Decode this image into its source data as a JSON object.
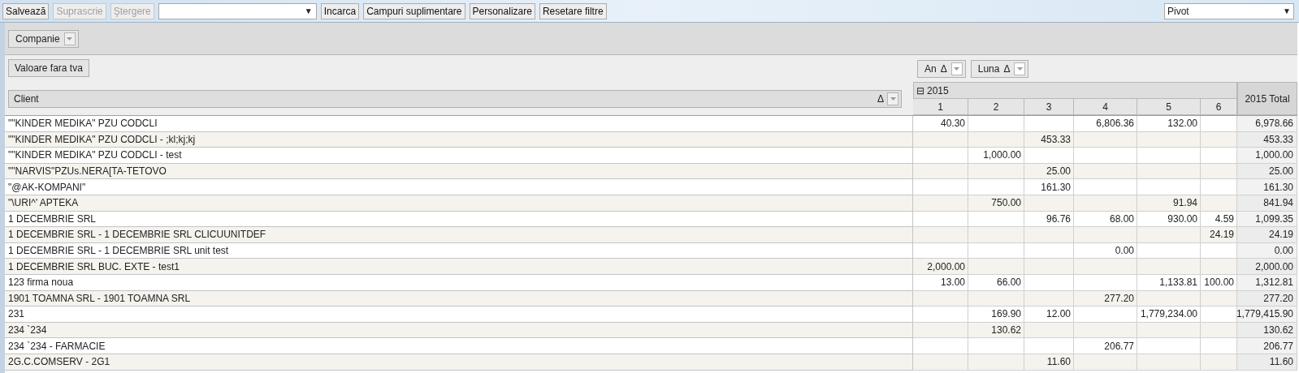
{
  "toolbar": {
    "buttons": [
      {
        "label": "Salvează",
        "disabled": false
      },
      {
        "label": "Suprascrie",
        "disabled": true
      },
      {
        "label": "Ştergere",
        "disabled": true
      }
    ],
    "layout_select": {
      "arrow": "▼"
    },
    "actions": [
      "Incarca",
      "Campuri suplimentare",
      "Personalizare",
      "Resetare filtre"
    ],
    "view_select": {
      "value": "Pivot",
      "arrow": "▼"
    }
  },
  "filter_area": {
    "fields": [
      {
        "label": "Companie"
      }
    ]
  },
  "data_area": {
    "fields": [
      {
        "label": "Valoare fara tva"
      }
    ]
  },
  "column_area": {
    "fields": [
      {
        "label": "An",
        "sort": "Δ"
      },
      {
        "label": "Luna",
        "sort": "Δ"
      }
    ]
  },
  "row_area": {
    "fields": [
      {
        "label": "Client",
        "sort": "Δ"
      }
    ]
  },
  "pivot": {
    "year": {
      "label": "2015",
      "expanded": true,
      "toggle": "⊟"
    },
    "months": [
      "1",
      "2",
      "3",
      "4",
      "5",
      "6"
    ],
    "total_label": "2015 Total",
    "rows": [
      {
        "client": "\"\"KINDER MEDIKA\" PZU CODCLI",
        "values": {
          "month_1": "40.30",
          "month_4": "6,806.36",
          "month_5": "132.00"
        },
        "total": "6,978.66"
      },
      {
        "client": "\"\"KINDER MEDIKA\" PZU CODCLI - ;kl;kj;kj",
        "values": {
          "month_3": "453.33"
        },
        "total": "453.33"
      },
      {
        "client": "\"\"KINDER MEDIKA\" PZU CODCLI - test",
        "values": {
          "month_2": "1,000.00"
        },
        "total": "1,000.00"
      },
      {
        "client": "\"\"NARVIS\"PZUs.NERA[TA-TETOVO",
        "values": {
          "month_3": "25.00"
        },
        "total": "25.00"
      },
      {
        "client": "\"@AK-KOMPANI\"",
        "values": {
          "month_3": "161.30"
        },
        "total": "161.30"
      },
      {
        "client": "\"\\URI^' APTEKA",
        "values": {
          "month_2": "750.00",
          "month_5": "91.94"
        },
        "total": "841.94"
      },
      {
        "client": "1 DECEMBRIE SRL",
        "values": {
          "month_3": "96.76",
          "month_4": "68.00",
          "month_5": "930.00",
          "month_6": "4.59"
        },
        "total": "1,099.35"
      },
      {
        "client": "1 DECEMBRIE SRL - 1 DECEMBRIE SRL CLICUUNITDEF",
        "values": {
          "month_6": "24.19"
        },
        "total": "24.19"
      },
      {
        "client": "1 DECEMBRIE SRL - 1 DECEMBRIE SRL unit test",
        "values": {
          "month_4": "0.00"
        },
        "total": "0.00"
      },
      {
        "client": "1 DECEMBRIE SRL BUC. EXTE - test1",
        "values": {
          "month_1": "2,000.00"
        },
        "total": "2,000.00"
      },
      {
        "client": "123 firma noua",
        "values": {
          "month_1": "13.00",
          "month_2": "66.00",
          "month_5": "1,133.81",
          "month_6": "100.00"
        },
        "total": "1,312.81"
      },
      {
        "client": "1901 TOAMNA SRL - 1901 TOAMNA SRL",
        "values": {
          "month_4": "277.20"
        },
        "total": "277.20"
      },
      {
        "client": "231",
        "values": {
          "month_2": "169.90",
          "month_3": "12.00",
          "month_5": "1,779,234.00"
        },
        "total": "1,779,415.90"
      },
      {
        "client": "234 `234",
        "values": {
          "month_2": "130.62"
        },
        "total": "130.62"
      },
      {
        "client": "234 `234 - FARMACIE",
        "values": {
          "month_4": "206.77"
        },
        "total": "206.77"
      },
      {
        "client": "2G.C.COMSERV - 2G1",
        "values": {
          "month_3": "11.60"
        },
        "total": "11.60"
      }
    ]
  }
}
